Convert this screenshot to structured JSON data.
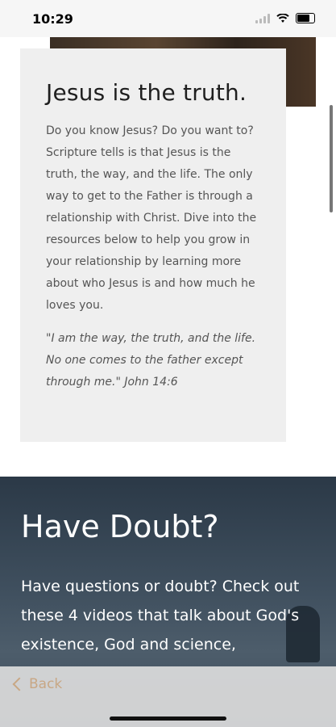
{
  "status_bar": {
    "time": "10:29"
  },
  "card": {
    "title": "Jesus is the truth.",
    "body": "Do you know Jesus? Do you want to? Scripture tells is that Jesus is the truth, the way, and the life. The only way to get to the Father is through a relationship with Christ. Dive into the resources below to help you grow in your relationship by learning more about who Jesus is and how much he loves you.",
    "quote": "\"I am the way, the truth, and the life. No one comes to the father except through me.\" John 14:6"
  },
  "doubt_section": {
    "title": "Have Doubt?",
    "body": "Have questions or doubt? Check out these 4 videos that talk about God's existence, God and science,"
  },
  "bottom_bar": {
    "back_label": "Back"
  },
  "colors": {
    "accent": "#c8a784",
    "card_bg": "#efefef"
  }
}
